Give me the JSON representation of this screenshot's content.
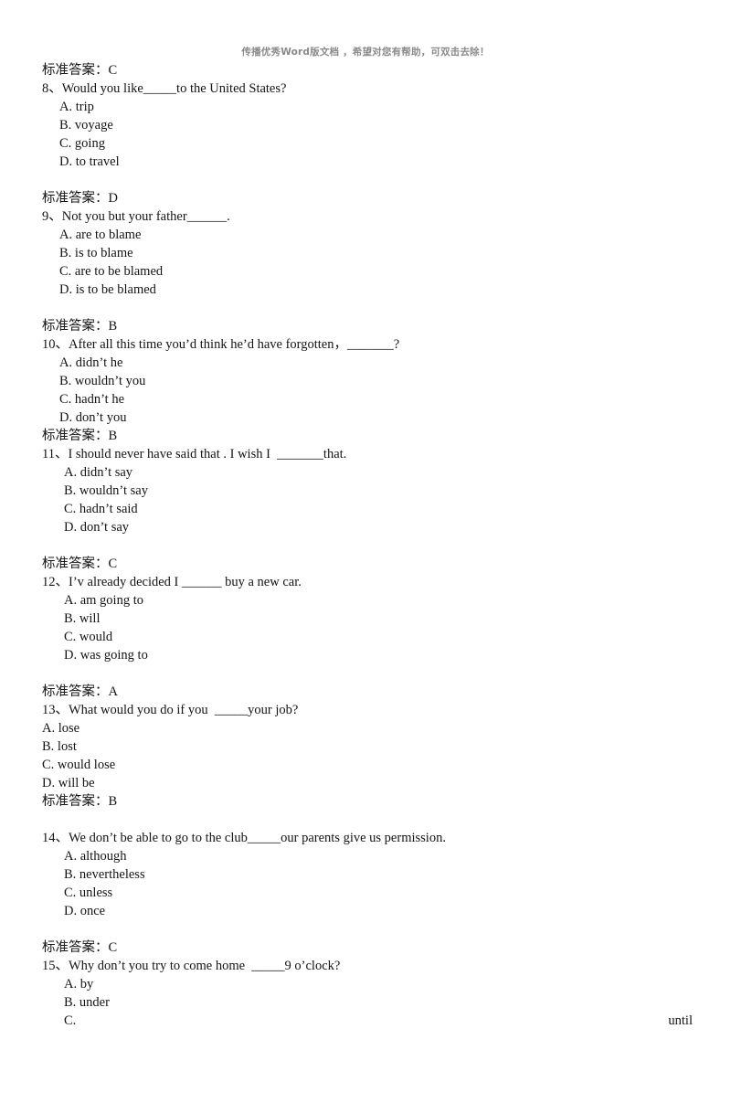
{
  "header": {
    "watermark": "传播优秀Word版文档 ，希望对您有帮助，可双击去除！"
  },
  "labels": {
    "answer_prefix": "标准答案："
  },
  "blocks": [
    {
      "type": "answer",
      "text": "标准答案：C"
    },
    {
      "type": "question",
      "number": "8",
      "stem": "8、Would you like_____to the United States?",
      "indent": "opt-ind",
      "options": [
        "A. trip",
        "B. voyage",
        "C. going",
        "D. to travel"
      ],
      "trailing_blank": true
    },
    {
      "type": "answer",
      "text": "标准答案：D"
    },
    {
      "type": "question",
      "number": "9",
      "stem": "9、Not you but your father______.",
      "indent": "opt-ind",
      "options": [
        "A. are to blame",
        "B. is to blame",
        "C. are to be blamed",
        "D. is to be blamed"
      ],
      "trailing_blank": true
    },
    {
      "type": "answer",
      "text": "标准答案：B"
    },
    {
      "type": "question",
      "number": "10",
      "stem": "10、After all this time you’d think he’d have forgotten，_______?",
      "indent": "opt-ind",
      "options": [
        "A. didn’t he",
        "B. wouldn’t you",
        "C. hadn’t he",
        "D. don’t you"
      ],
      "trailing_blank": false
    },
    {
      "type": "answer",
      "text": "标准答案：B"
    },
    {
      "type": "question",
      "number": "11",
      "stem": "11、I should never have said that . I wish I  _______that.",
      "indent": "opt-ind2",
      "options": [
        "A. didn’t say",
        "B. wouldn’t say",
        "C. hadn’t said",
        "D. don’t say"
      ],
      "trailing_blank": true
    },
    {
      "type": "answer",
      "text": "标准答案：C"
    },
    {
      "type": "question",
      "number": "12",
      "stem": "12、I’v already decided I ______ buy a new car.",
      "indent": "opt-ind2",
      "options": [
        "A. am going to",
        "B. will",
        "C. would",
        "D. was going to"
      ],
      "trailing_blank": true
    },
    {
      "type": "answer",
      "text": "标准答案：A"
    },
    {
      "type": "question",
      "number": "13",
      "stem": "13、What would you do if you  _____your job?",
      "indent": "opt-flush",
      "options": [
        "A. lose",
        "B. lost",
        "C. would lose",
        "D. will be"
      ],
      "trailing_blank": false
    },
    {
      "type": "answer",
      "text": "标准答案：B"
    },
    {
      "type": "blank"
    },
    {
      "type": "question",
      "number": "14",
      "stem": "14、We don’t be able to go to the club_____our parents give us permission.",
      "indent": "opt-ind2",
      "options": [
        "A. although",
        "B. nevertheless",
        "C. unless",
        "D. once"
      ],
      "trailing_blank": true
    },
    {
      "type": "answer",
      "text": "标准答案：C"
    },
    {
      "type": "question",
      "number": "15",
      "stem": "15、Why don’t you try to come home  _____9 o’clock?",
      "indent": "opt-ind2",
      "options": [
        "A. by",
        "B. under"
      ],
      "split_option": {
        "left": "C.",
        "right": "until"
      },
      "trailing_blank": false
    }
  ]
}
